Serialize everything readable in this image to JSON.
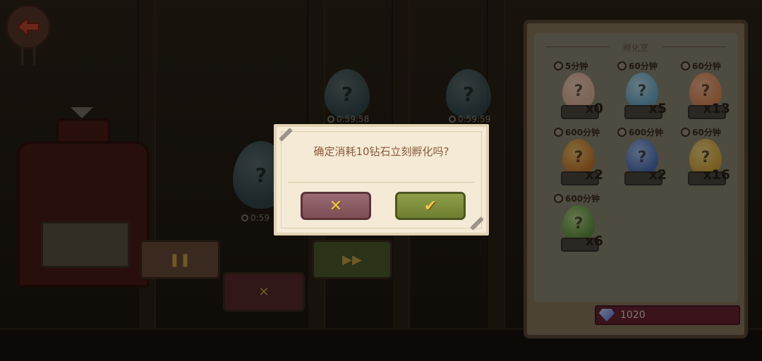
{
  "dialog": {
    "message": "确定消耗10钻石立刻孵化吗?",
    "cancel_icon": "hammer-cross-icon",
    "confirm_icon": "checkmark-icon"
  },
  "background": {
    "timers": [
      "0:59:58",
      "0:59:59",
      "0:59"
    ],
    "buttons": {
      "pause_icon": "pause-icon",
      "fast_forward_icon": "fast-forward-icon",
      "cancel_icon": "hammer-cross-icon"
    }
  },
  "panel": {
    "title": "孵化室",
    "eggs": [
      {
        "time": "5分钟",
        "quantity": "x0",
        "color": "#e2b49a"
      },
      {
        "time": "60分钟",
        "quantity": "x5",
        "color": "#6aa9c8"
      },
      {
        "time": "60分钟",
        "quantity": "x13",
        "color": "#e08a58"
      },
      {
        "time": "600分钟",
        "quantity": "x2",
        "color": "#d9a040"
      },
      {
        "time": "600分钟",
        "quantity": "x2",
        "color": "#5d84c8"
      },
      {
        "time": "60分钟",
        "quantity": "x16",
        "color": "#e2b84a"
      },
      {
        "time": "600分钟",
        "quantity": "x6",
        "color": "#7fae54"
      }
    ],
    "diamonds": "1020"
  }
}
